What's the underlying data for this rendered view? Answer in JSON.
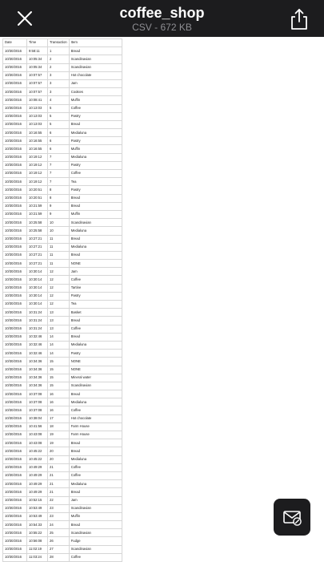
{
  "header": {
    "title": "coffee_shop",
    "subtitle": "CSV - 672 KB"
  },
  "icons": {
    "close": "close-icon",
    "share": "share-icon",
    "markup": "markup-icon"
  },
  "colors": {
    "topbar": "#1c1c1e",
    "title": "#ffffff",
    "subtitle": "#8e8e93",
    "grid": "#d6d6d6"
  },
  "sheet": {
    "headers": [
      "Date",
      "Time",
      "Transaction",
      "Item"
    ],
    "rows": [
      [
        "10/30/2016",
        "9:58:11",
        "1",
        "Bread"
      ],
      [
        "10/30/2016",
        "10:05:34",
        "2",
        "Scandinavian"
      ],
      [
        "10/30/2016",
        "10:05:34",
        "2",
        "Scandinavian"
      ],
      [
        "10/30/2016",
        "10:07:57",
        "3",
        "Hot chocolate"
      ],
      [
        "10/30/2016",
        "10:07:57",
        "3",
        "Jam"
      ],
      [
        "10/30/2016",
        "10:07:57",
        "3",
        "Cookies"
      ],
      [
        "10/30/2016",
        "10:08:41",
        "4",
        "Muffin"
      ],
      [
        "10/30/2016",
        "10:13:03",
        "5",
        "Coffee"
      ],
      [
        "10/30/2016",
        "10:13:03",
        "5",
        "Pastry"
      ],
      [
        "10/30/2016",
        "10:13:03",
        "5",
        "Bread"
      ],
      [
        "10/30/2016",
        "10:16:55",
        "6",
        "Medialuna"
      ],
      [
        "10/30/2016",
        "10:16:55",
        "6",
        "Pastry"
      ],
      [
        "10/30/2016",
        "10:16:55",
        "6",
        "Muffin"
      ],
      [
        "10/30/2016",
        "10:19:12",
        "7",
        "Medialuna"
      ],
      [
        "10/30/2016",
        "10:19:12",
        "7",
        "Pastry"
      ],
      [
        "10/30/2016",
        "10:19:12",
        "7",
        "Coffee"
      ],
      [
        "10/30/2016",
        "10:19:12",
        "7",
        "Tea"
      ],
      [
        "10/30/2016",
        "10:20:51",
        "8",
        "Pastry"
      ],
      [
        "10/30/2016",
        "10:20:51",
        "8",
        "Bread"
      ],
      [
        "10/30/2016",
        "10:21:59",
        "9",
        "Bread"
      ],
      [
        "10/30/2016",
        "10:21:59",
        "9",
        "Muffin"
      ],
      [
        "10/30/2016",
        "10:25:58",
        "10",
        "Scandinavian"
      ],
      [
        "10/30/2016",
        "10:25:58",
        "10",
        "Medialuna"
      ],
      [
        "10/30/2016",
        "10:27:21",
        "11",
        "Bread"
      ],
      [
        "10/30/2016",
        "10:27:21",
        "11",
        "Medialuna"
      ],
      [
        "10/30/2016",
        "10:27:21",
        "11",
        "Bread"
      ],
      [
        "10/30/2016",
        "10:27:21",
        "11",
        "NONE"
      ],
      [
        "10/30/2016",
        "10:30:14",
        "12",
        "Jam"
      ],
      [
        "10/30/2016",
        "10:30:14",
        "12",
        "Coffee"
      ],
      [
        "10/30/2016",
        "10:30:14",
        "12",
        "Tartine"
      ],
      [
        "10/30/2016",
        "10:30:14",
        "12",
        "Pastry"
      ],
      [
        "10/30/2016",
        "10:30:14",
        "12",
        "Tea"
      ],
      [
        "10/30/2016",
        "10:31:24",
        "13",
        "Basket"
      ],
      [
        "10/30/2016",
        "10:31:24",
        "13",
        "Bread"
      ],
      [
        "10/30/2016",
        "10:31:24",
        "13",
        "Coffee"
      ],
      [
        "10/30/2016",
        "10:32:46",
        "14",
        "Bread"
      ],
      [
        "10/30/2016",
        "10:32:46",
        "14",
        "Medialuna"
      ],
      [
        "10/30/2016",
        "10:32:46",
        "14",
        "Pastry"
      ],
      [
        "10/30/2016",
        "10:34:36",
        "15",
        "NONE"
      ],
      [
        "10/30/2016",
        "10:34:36",
        "15",
        "NONE"
      ],
      [
        "10/30/2016",
        "10:34:36",
        "15",
        "Mineral water"
      ],
      [
        "10/30/2016",
        "10:34:36",
        "15",
        "Scandinavian"
      ],
      [
        "10/30/2016",
        "10:37:08",
        "16",
        "Bread"
      ],
      [
        "10/30/2016",
        "10:37:08",
        "16",
        "Medialuna"
      ],
      [
        "10/30/2016",
        "10:37:08",
        "16",
        "Coffee"
      ],
      [
        "10/30/2016",
        "10:38:04",
        "17",
        "Hot chocolate"
      ],
      [
        "10/30/2016",
        "10:41:56",
        "18",
        "Farm House"
      ],
      [
        "10/30/2016",
        "10:43:08",
        "19",
        "Farm House"
      ],
      [
        "10/30/2016",
        "10:43:08",
        "19",
        "Bread"
      ],
      [
        "10/30/2016",
        "10:45:22",
        "20",
        "Bread"
      ],
      [
        "10/30/2016",
        "10:45:22",
        "20",
        "Medialuna"
      ],
      [
        "10/30/2016",
        "10:49:29",
        "21",
        "Coffee"
      ],
      [
        "10/30/2016",
        "10:49:29",
        "21",
        "Coffee"
      ],
      [
        "10/30/2016",
        "10:49:29",
        "21",
        "Medialuna"
      ],
      [
        "10/30/2016",
        "10:49:29",
        "21",
        "Bread"
      ],
      [
        "10/30/2016",
        "10:52:15",
        "22",
        "Jam"
      ],
      [
        "10/30/2016",
        "10:53:49",
        "23",
        "Scandinavian"
      ],
      [
        "10/30/2016",
        "10:53:49",
        "23",
        "Muffin"
      ],
      [
        "10/30/2016",
        "10:54:33",
        "24",
        "Bread"
      ],
      [
        "10/30/2016",
        "10:55:22",
        "25",
        "Scandinavian"
      ],
      [
        "10/30/2016",
        "10:56:08",
        "26",
        "Fudge"
      ],
      [
        "10/30/2016",
        "11:02:19",
        "27",
        "Scandinavian"
      ],
      [
        "10/30/2016",
        "11:03:24",
        "28",
        "Coffee"
      ]
    ]
  }
}
